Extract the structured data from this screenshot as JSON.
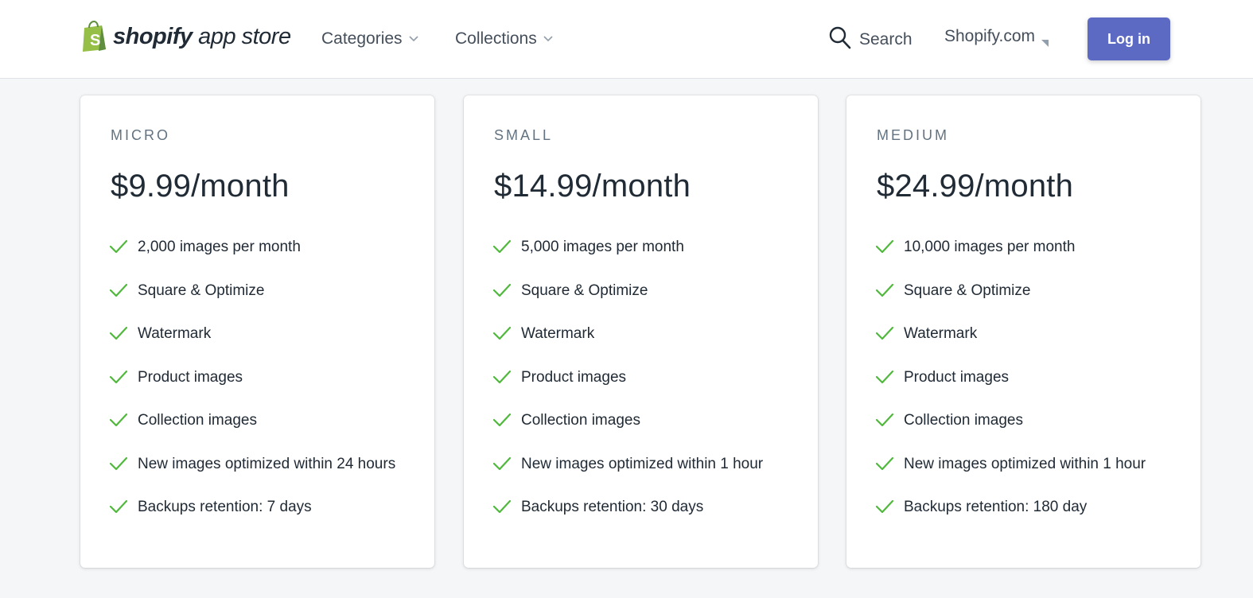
{
  "header": {
    "logo_brand": "shopify",
    "logo_rest": " app store",
    "nav": [
      {
        "label": "Categories",
        "icon": "chevron-down-icon"
      },
      {
        "label": "Collections",
        "icon": "chevron-down-icon"
      }
    ],
    "search_label": "Search",
    "shopify_link": "Shopify.com",
    "login_label": "Log in"
  },
  "colors": {
    "accent": "#5c6ac4",
    "check": "#50b83c",
    "logo_green": "#95bf47",
    "text_muted": "#637381"
  },
  "plans": [
    {
      "name": "MICRO",
      "price": "$9.99/month",
      "features": [
        "2,000 images per month",
        "Square & Optimize",
        "Watermark",
        "Product images",
        "Collection images",
        "New images optimized within 24 hours",
        "Backups retention: 7 days"
      ]
    },
    {
      "name": "SMALL",
      "price": "$14.99/month",
      "features": [
        "5,000 images per month",
        "Square & Optimize",
        "Watermark",
        "Product images",
        "Collection images",
        "New images optimized within 1 hour",
        "Backups retention: 30 days"
      ]
    },
    {
      "name": "MEDIUM",
      "price": "$24.99/month",
      "features": [
        "10,000 images per month",
        "Square & Optimize",
        "Watermark",
        "Product images",
        "Collection images",
        "New images optimized within 1 hour",
        "Backups retention: 180 day"
      ]
    }
  ]
}
